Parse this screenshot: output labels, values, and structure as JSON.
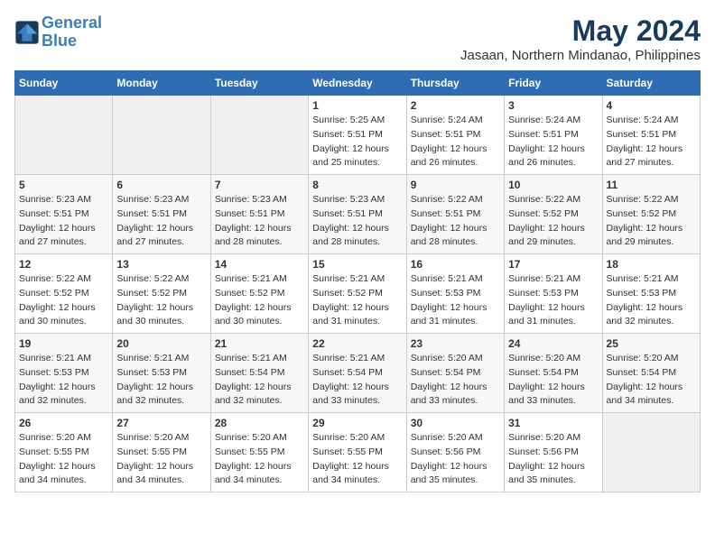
{
  "header": {
    "logo_line1": "General",
    "logo_line2": "Blue",
    "month": "May 2024",
    "location": "Jasaan, Northern Mindanao, Philippines"
  },
  "days_of_week": [
    "Sunday",
    "Monday",
    "Tuesday",
    "Wednesday",
    "Thursday",
    "Friday",
    "Saturday"
  ],
  "weeks": [
    [
      {
        "day": "",
        "info": ""
      },
      {
        "day": "",
        "info": ""
      },
      {
        "day": "",
        "info": ""
      },
      {
        "day": "1",
        "info": "Sunrise: 5:25 AM\nSunset: 5:51 PM\nDaylight: 12 hours\nand 25 minutes."
      },
      {
        "day": "2",
        "info": "Sunrise: 5:24 AM\nSunset: 5:51 PM\nDaylight: 12 hours\nand 26 minutes."
      },
      {
        "day": "3",
        "info": "Sunrise: 5:24 AM\nSunset: 5:51 PM\nDaylight: 12 hours\nand 26 minutes."
      },
      {
        "day": "4",
        "info": "Sunrise: 5:24 AM\nSunset: 5:51 PM\nDaylight: 12 hours\nand 27 minutes."
      }
    ],
    [
      {
        "day": "5",
        "info": "Sunrise: 5:23 AM\nSunset: 5:51 PM\nDaylight: 12 hours\nand 27 minutes."
      },
      {
        "day": "6",
        "info": "Sunrise: 5:23 AM\nSunset: 5:51 PM\nDaylight: 12 hours\nand 27 minutes."
      },
      {
        "day": "7",
        "info": "Sunrise: 5:23 AM\nSunset: 5:51 PM\nDaylight: 12 hours\nand 28 minutes."
      },
      {
        "day": "8",
        "info": "Sunrise: 5:23 AM\nSunset: 5:51 PM\nDaylight: 12 hours\nand 28 minutes."
      },
      {
        "day": "9",
        "info": "Sunrise: 5:22 AM\nSunset: 5:51 PM\nDaylight: 12 hours\nand 28 minutes."
      },
      {
        "day": "10",
        "info": "Sunrise: 5:22 AM\nSunset: 5:52 PM\nDaylight: 12 hours\nand 29 minutes."
      },
      {
        "day": "11",
        "info": "Sunrise: 5:22 AM\nSunset: 5:52 PM\nDaylight: 12 hours\nand 29 minutes."
      }
    ],
    [
      {
        "day": "12",
        "info": "Sunrise: 5:22 AM\nSunset: 5:52 PM\nDaylight: 12 hours\nand 30 minutes."
      },
      {
        "day": "13",
        "info": "Sunrise: 5:22 AM\nSunset: 5:52 PM\nDaylight: 12 hours\nand 30 minutes."
      },
      {
        "day": "14",
        "info": "Sunrise: 5:21 AM\nSunset: 5:52 PM\nDaylight: 12 hours\nand 30 minutes."
      },
      {
        "day": "15",
        "info": "Sunrise: 5:21 AM\nSunset: 5:52 PM\nDaylight: 12 hours\nand 31 minutes."
      },
      {
        "day": "16",
        "info": "Sunrise: 5:21 AM\nSunset: 5:53 PM\nDaylight: 12 hours\nand 31 minutes."
      },
      {
        "day": "17",
        "info": "Sunrise: 5:21 AM\nSunset: 5:53 PM\nDaylight: 12 hours\nand 31 minutes."
      },
      {
        "day": "18",
        "info": "Sunrise: 5:21 AM\nSunset: 5:53 PM\nDaylight: 12 hours\nand 32 minutes."
      }
    ],
    [
      {
        "day": "19",
        "info": "Sunrise: 5:21 AM\nSunset: 5:53 PM\nDaylight: 12 hours\nand 32 minutes."
      },
      {
        "day": "20",
        "info": "Sunrise: 5:21 AM\nSunset: 5:53 PM\nDaylight: 12 hours\nand 32 minutes."
      },
      {
        "day": "21",
        "info": "Sunrise: 5:21 AM\nSunset: 5:54 PM\nDaylight: 12 hours\nand 32 minutes."
      },
      {
        "day": "22",
        "info": "Sunrise: 5:21 AM\nSunset: 5:54 PM\nDaylight: 12 hours\nand 33 minutes."
      },
      {
        "day": "23",
        "info": "Sunrise: 5:20 AM\nSunset: 5:54 PM\nDaylight: 12 hours\nand 33 minutes."
      },
      {
        "day": "24",
        "info": "Sunrise: 5:20 AM\nSunset: 5:54 PM\nDaylight: 12 hours\nand 33 minutes."
      },
      {
        "day": "25",
        "info": "Sunrise: 5:20 AM\nSunset: 5:54 PM\nDaylight: 12 hours\nand 34 minutes."
      }
    ],
    [
      {
        "day": "26",
        "info": "Sunrise: 5:20 AM\nSunset: 5:55 PM\nDaylight: 12 hours\nand 34 minutes."
      },
      {
        "day": "27",
        "info": "Sunrise: 5:20 AM\nSunset: 5:55 PM\nDaylight: 12 hours\nand 34 minutes."
      },
      {
        "day": "28",
        "info": "Sunrise: 5:20 AM\nSunset: 5:55 PM\nDaylight: 12 hours\nand 34 minutes."
      },
      {
        "day": "29",
        "info": "Sunrise: 5:20 AM\nSunset: 5:55 PM\nDaylight: 12 hours\nand 34 minutes."
      },
      {
        "day": "30",
        "info": "Sunrise: 5:20 AM\nSunset: 5:56 PM\nDaylight: 12 hours\nand 35 minutes."
      },
      {
        "day": "31",
        "info": "Sunrise: 5:20 AM\nSunset: 5:56 PM\nDaylight: 12 hours\nand 35 minutes."
      },
      {
        "day": "",
        "info": ""
      }
    ]
  ]
}
